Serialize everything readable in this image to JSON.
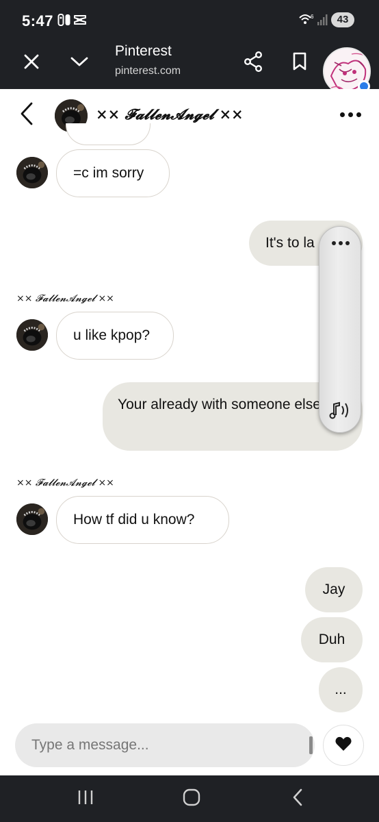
{
  "status_bar": {
    "time": "5:47",
    "battery": "43",
    "icons": [
      "nintendo-switch-icon",
      "capcut-icon",
      "wifi-6-icon",
      "signal-icon",
      "battery-icon"
    ]
  },
  "browser": {
    "title": "Pinterest",
    "url": "pinterest.com",
    "icons": [
      "close-icon",
      "chevron-down-icon",
      "share-icon",
      "bookmark-icon"
    ]
  },
  "chat": {
    "contact_name": "×× 𝓕𝓪𝓵𝓵𝓮𝓷𝓐𝓷𝓰𝓮𝓵 ××",
    "sender_label": "×× 𝓕𝓪𝓵𝓵𝓮𝓷𝓐𝓷𝓰𝓮𝓵 ××",
    "messages": [
      {
        "from": "them",
        "text": "=c im sorry"
      },
      {
        "from": "me",
        "text": "It's to la"
      },
      {
        "from": "them",
        "text": "u like kpop?"
      },
      {
        "from": "me",
        "text": "Your already with someone else"
      },
      {
        "from": "them",
        "text": "How tf did u know?"
      },
      {
        "from": "me",
        "text": "Jay"
      },
      {
        "from": "me",
        "text": "Duh"
      },
      {
        "from": "me",
        "text": "..."
      }
    ]
  },
  "composer": {
    "placeholder": "Type a message..."
  },
  "colors": {
    "bar_background": "#1f2125",
    "outgoing_bubble": "#e8e7e1",
    "incoming_border": "#d8d3cc"
  }
}
